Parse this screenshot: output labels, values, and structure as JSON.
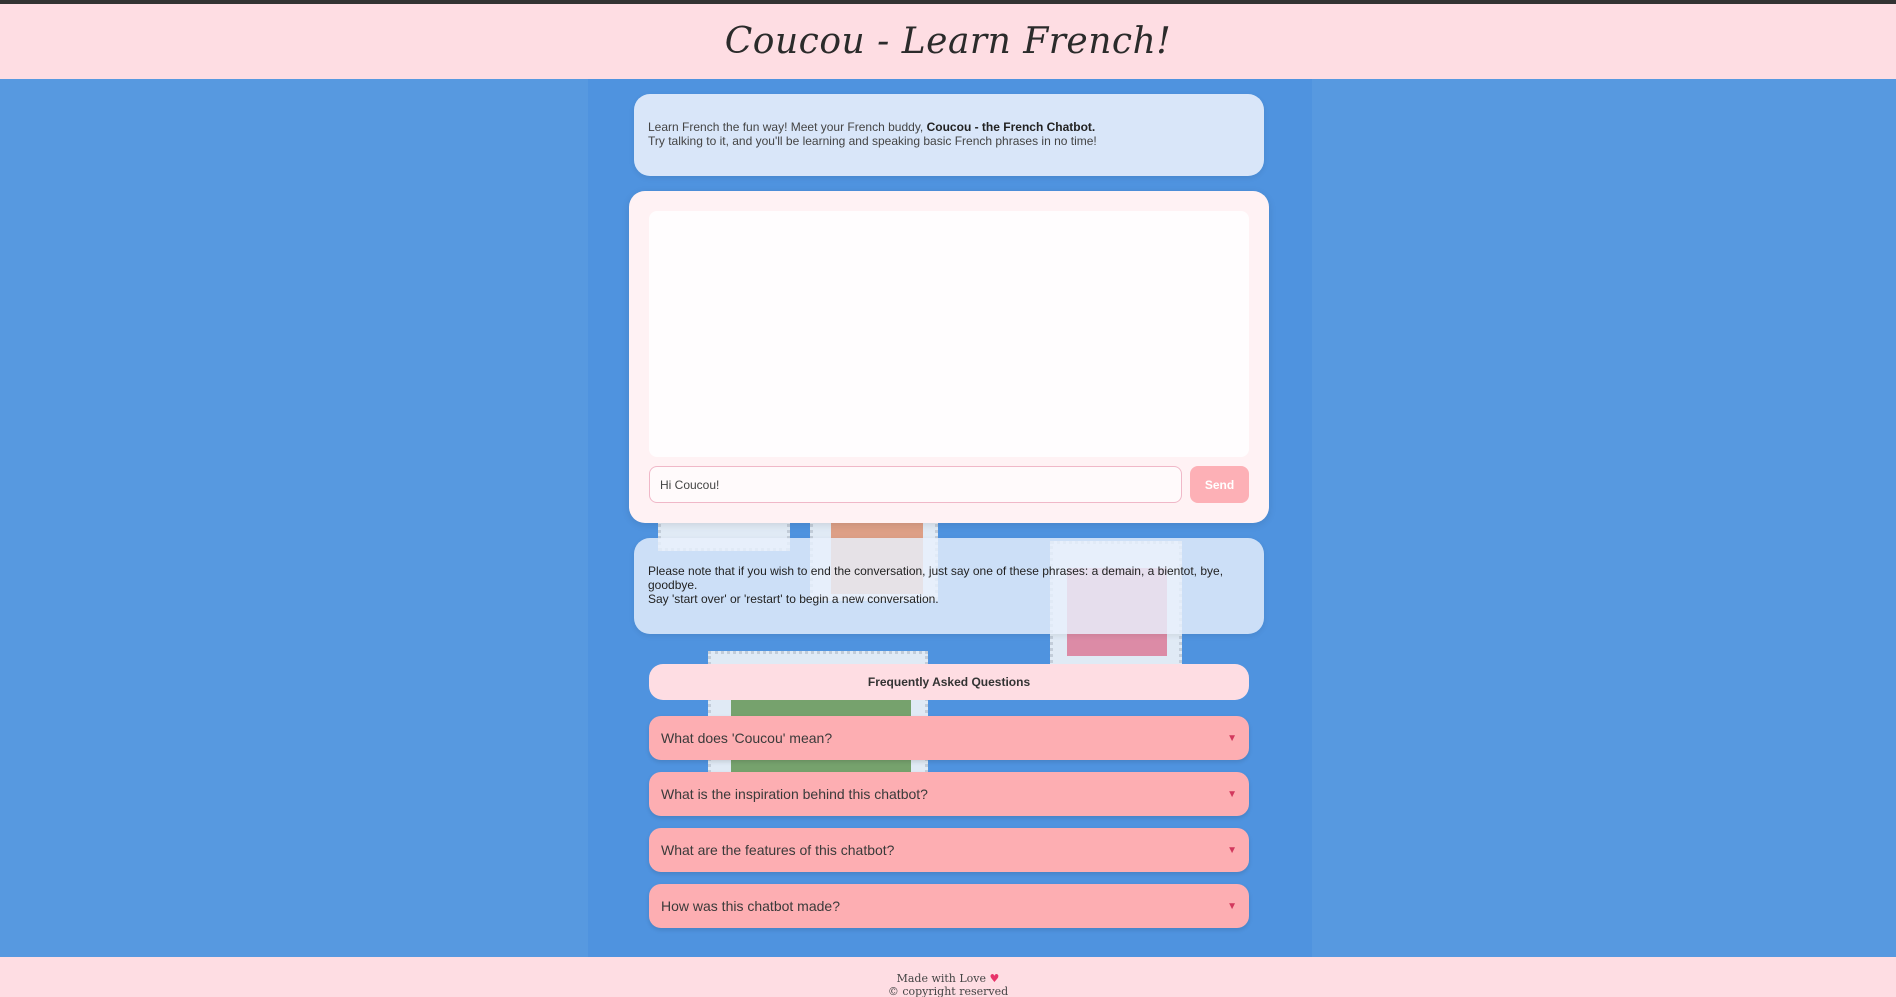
{
  "header": {
    "title": "Coucou - Learn French!"
  },
  "intro": {
    "line1_prefix": "Learn French the fun way! Meet your French buddy,",
    "line1_bold": "Coucou - the French Chatbot.",
    "line2": "Try talking to it, and you'll be learning and speaking basic French phrases in no time!"
  },
  "chat": {
    "input_value": "Hi Coucou!",
    "send_label": "Send"
  },
  "note": {
    "line1": "Please note that if you wish to end the conversation, just say one of these phrases: a demain, a bientot, bye, goodbye.",
    "line2": "Say 'start over' or 'restart' to begin a new conversation."
  },
  "faq": {
    "title": "Frequently Asked Questions",
    "items": [
      {
        "question": "What does 'Coucou' mean?",
        "icon": "triangle-down-icon"
      },
      {
        "question": "What is the inspiration behind this chatbot?",
        "icon": "triangle-down-icon"
      },
      {
        "question": "What are the features of this chatbot?",
        "icon": "triangle-down-icon"
      },
      {
        "question": "How was this chatbot made?",
        "icon": "triangle-down-icon"
      }
    ]
  },
  "footer": {
    "made_with": "Made with Love",
    "copyright": "© copyright reserved",
    "heart_icon": "heart-icon"
  },
  "colors": {
    "page_background": "#5799e0",
    "header_background": "#fedde3",
    "faq_item_background": "#fdaeb2",
    "send_button": "#fdb0b6",
    "arrow": "#d2385d"
  }
}
